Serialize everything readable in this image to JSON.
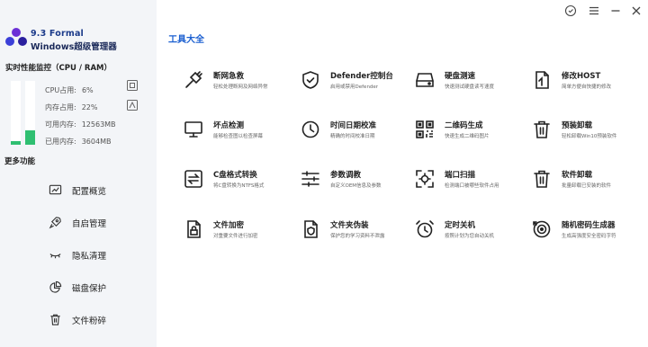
{
  "app": {
    "version": "9.3 Formal",
    "name": "Windows超级管理器"
  },
  "monitor": {
    "title": "实时性能监控（CPU / RAM）",
    "cpu_label": "CPU占用:",
    "cpu_value": "6%",
    "cpu_percent": 6,
    "mem_label": "内存占用:",
    "mem_value": "22%",
    "mem_percent": 22,
    "avail_label": "可用内存:",
    "avail_value": "12563MB",
    "used_label": "已用内存:",
    "used_value": "3604MB"
  },
  "sidebar": {
    "more_title": "更多功能",
    "items": [
      {
        "label": "配置概览",
        "icon": "chart-icon"
      },
      {
        "label": "自启管理",
        "icon": "rocket-icon"
      },
      {
        "label": "隐私清理",
        "icon": "eye-closed-icon"
      },
      {
        "label": "磁盘保护",
        "icon": "pie-icon"
      },
      {
        "label": "文件粉碎",
        "icon": "trash-icon"
      }
    ]
  },
  "main": {
    "section_title": "工具大全",
    "tools": [
      {
        "title": "断网急救",
        "desc": "轻松处理断网及网络异常",
        "icon": "plug-icon"
      },
      {
        "title": "Defender控制台",
        "desc": "启用或禁用Defender",
        "icon": "shield-icon"
      },
      {
        "title": "硬盘测速",
        "desc": "快速测试硬盘读写速度",
        "icon": "hdd-icon"
      },
      {
        "title": "修改HOST",
        "desc": "简单方便自快捷的修改",
        "icon": "host-file-icon"
      },
      {
        "title": "坏点检测",
        "desc": "能够检查图以检查屏幕",
        "icon": "monitor-icon"
      },
      {
        "title": "时间日期校准",
        "desc": "精确的时间校准日期",
        "icon": "clock-icon"
      },
      {
        "title": "二维码生成",
        "desc": "快速生成二维码图片",
        "icon": "qr-icon"
      },
      {
        "title": "预装卸载",
        "desc": "轻松卸载Win10预装软件",
        "icon": "trash-icon"
      },
      {
        "title": "C盘格式转换",
        "desc": "将C盘转换为NTFS格式",
        "icon": "convert-icon"
      },
      {
        "title": "参数调教",
        "desc": "自定义OEM信息及参数",
        "icon": "sliders-icon"
      },
      {
        "title": "端口扫描",
        "desc": "检测端口被哪些软件占用",
        "icon": "scan-icon"
      },
      {
        "title": "软件卸载",
        "desc": "批量卸载已安装的软件",
        "icon": "trash-icon"
      },
      {
        "title": "文件加密",
        "desc": "对重要文件进行加密",
        "icon": "file-lock-icon"
      },
      {
        "title": "文件夹伪装",
        "desc": "保护您的学习资料不泄露",
        "icon": "file-shield-icon"
      },
      {
        "title": "定时关机",
        "desc": "按照计划为您自动关机",
        "icon": "alarm-icon"
      },
      {
        "title": "随机密码生成器",
        "desc": "生成高强度安全密码字符",
        "icon": "password-icon"
      }
    ]
  },
  "colors": {
    "accent": "#1b5fd0",
    "meter_fill": "#2fbf71",
    "sidebar_bg": "#f3f5f8"
  }
}
